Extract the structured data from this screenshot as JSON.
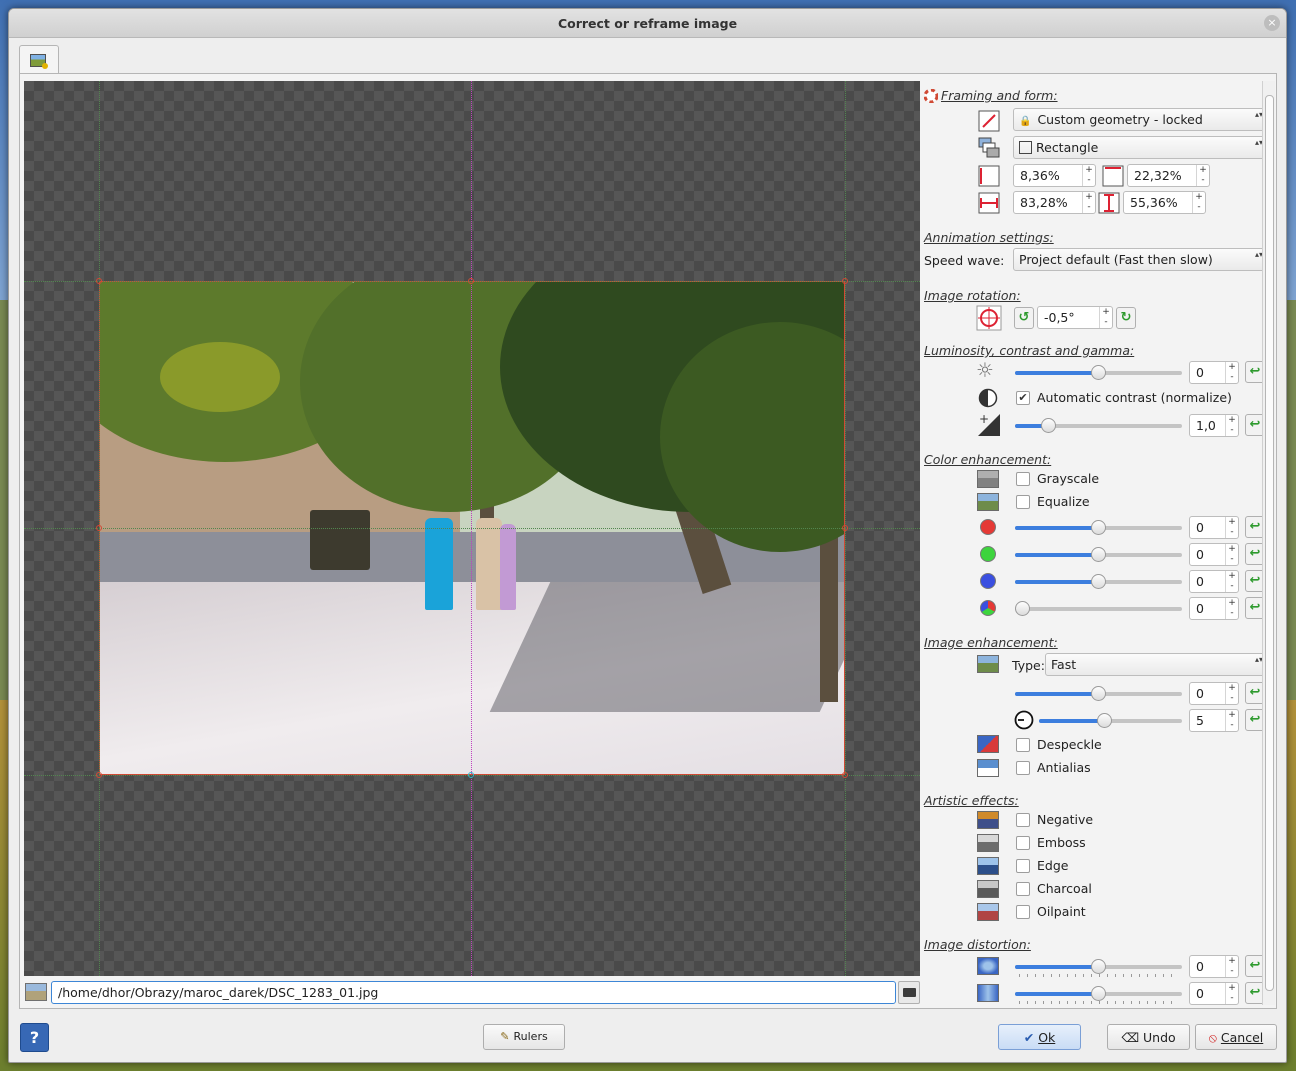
{
  "window": {
    "title": "Correct or reframe image",
    "close_glyph": "×"
  },
  "image_path": "/home/dhor/Obrazy/maroc_darek/DSC_1283_01.jpg",
  "framing": {
    "title": "Framing and form:",
    "geometry": "Custom geometry - locked",
    "shape": "Rectangle",
    "x": "8,36%",
    "y": "22,32%",
    "width": "83,28%",
    "height": "55,36%"
  },
  "animation": {
    "title": "Annimation settings:",
    "speed_label": "Speed wave:",
    "speed_value": "Project default (Fast then slow)"
  },
  "rotation": {
    "title": "Image rotation:",
    "value": "-0,5°"
  },
  "luminosity": {
    "title": "Luminosity, contrast and gamma:",
    "brightness": "0",
    "brightness_level": 0.5,
    "auto_contrast_label": "Automatic contrast (normalize)",
    "auto_contrast_checked": true,
    "gamma": "1,0",
    "gamma_level": 0.2
  },
  "color": {
    "title": "Color enhancement:",
    "grayscale_label": "Grayscale",
    "equalize_label": "Equalize",
    "red": "0",
    "green": "0",
    "blue": "0",
    "saturation": "0",
    "red_color": "#e53935",
    "green_color": "#3dd43d",
    "blue_color": "#3a4fe0"
  },
  "enhancement": {
    "title": "Image enhancement:",
    "type_label": "Type:",
    "type_value": "Fast",
    "amount": "0",
    "radius": "5",
    "despeckle_label": "Despeckle",
    "antialias_label": "Antialias"
  },
  "artistic": {
    "title": "Artistic effects:",
    "items": [
      "Negative",
      "Emboss",
      "Edge",
      "Charcoal",
      "Oilpaint"
    ]
  },
  "distortion": {
    "title": "Image distortion:",
    "swirl": "0",
    "implode": "0"
  },
  "buttons": {
    "help": "?",
    "rulers": "Rulers",
    "ok": "Ok",
    "undo": "Undo",
    "cancel": "Cancel"
  },
  "spin_glyph": "+\n-",
  "reset_glyph": "↩"
}
